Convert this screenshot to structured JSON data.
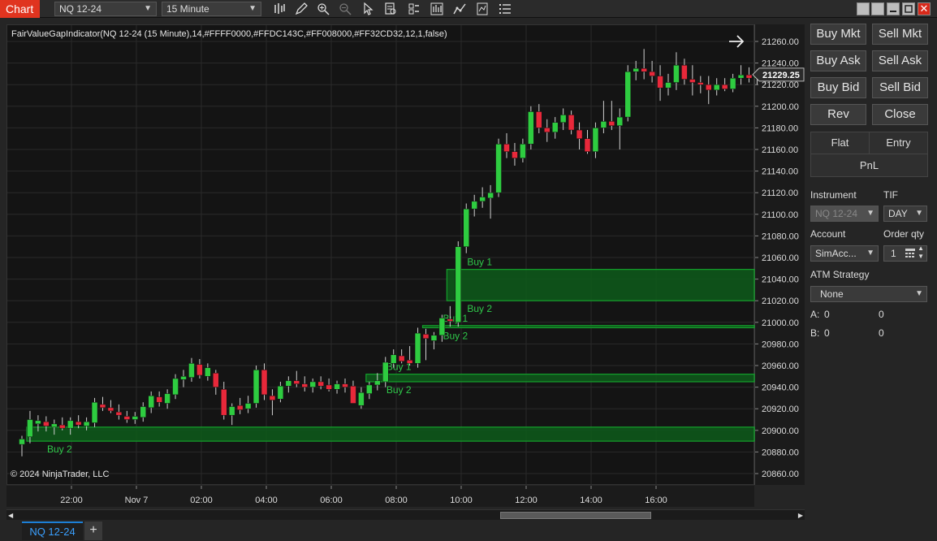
{
  "toolbar": {
    "chart_tab": "Chart",
    "instrument": "NQ 12-24",
    "period": "15 Minute",
    "icons": [
      "bars-icon",
      "pencil-icon",
      "zoom-in-icon",
      "zoom-out-icon",
      "pointer-icon",
      "data-box-icon",
      "properties-icon",
      "strategy-icon",
      "indicator-icon",
      "templates-icon",
      "list-icon"
    ]
  },
  "chart": {
    "indicator_label": "FairValueGapIndicator(NQ 12-24 (15 Minute),14,#FFFF0000,#FFDC143C,#FF008000,#FF32CD32,12,1,false)",
    "copyright": "© 2024 NinjaTrader, LLC",
    "last_price": "21229.25",
    "colors": {
      "up": "#2ecc40",
      "down": "#e8283a",
      "zone_fill": "#0d5a1a",
      "zone_border": "#14a12c",
      "zone_text": "#2fc94a",
      "bg": "#141414",
      "grid": "#2a2a2a"
    }
  },
  "chart_data": {
    "type": "candlestick",
    "y_ticks": [
      "21260.00",
      "21240.00",
      "21220.00",
      "21200.00",
      "21180.00",
      "21160.00",
      "21140.00",
      "21120.00",
      "21100.00",
      "21080.00",
      "21060.00",
      "21040.00",
      "21020.00",
      "21000.00",
      "20980.00",
      "20960.00",
      "20940.00",
      "20920.00",
      "20900.00",
      "20880.00",
      "20860.00"
    ],
    "x_ticks": [
      "22:00",
      "Nov 7",
      "02:00",
      "04:00",
      "06:00",
      "08:00",
      "10:00",
      "12:00",
      "14:00",
      "16:00"
    ],
    "ylim": [
      20848,
      21268
    ],
    "candles": [
      {
        "o": 20887,
        "h": 20895,
        "l": 20876,
        "c": 20892
      },
      {
        "o": 20894,
        "h": 20918,
        "l": 20888,
        "c": 20910
      },
      {
        "o": 20906,
        "h": 20914,
        "l": 20899,
        "c": 20909
      },
      {
        "o": 20908,
        "h": 20913,
        "l": 20899,
        "c": 20904
      },
      {
        "o": 20903,
        "h": 20910,
        "l": 20896,
        "c": 20906
      },
      {
        "o": 20905,
        "h": 20912,
        "l": 20900,
        "c": 20902
      },
      {
        "o": 20902,
        "h": 20912,
        "l": 20896,
        "c": 20909
      },
      {
        "o": 20908,
        "h": 20914,
        "l": 20902,
        "c": 20905
      },
      {
        "o": 20904,
        "h": 20912,
        "l": 20900,
        "c": 20908
      },
      {
        "o": 20907,
        "h": 20930,
        "l": 20903,
        "c": 20926
      },
      {
        "o": 20924,
        "h": 20931,
        "l": 20918,
        "c": 20921
      },
      {
        "o": 20921,
        "h": 20928,
        "l": 20916,
        "c": 20918
      },
      {
        "o": 20917,
        "h": 20924,
        "l": 20910,
        "c": 20914
      },
      {
        "o": 20913,
        "h": 20918,
        "l": 20907,
        "c": 20910
      },
      {
        "o": 20910,
        "h": 20917,
        "l": 20906,
        "c": 20913
      },
      {
        "o": 20912,
        "h": 20926,
        "l": 20908,
        "c": 20922
      },
      {
        "o": 20921,
        "h": 20936,
        "l": 20916,
        "c": 20932
      },
      {
        "o": 20931,
        "h": 20936,
        "l": 20922,
        "c": 20926
      },
      {
        "o": 20925,
        "h": 20938,
        "l": 20920,
        "c": 20934
      },
      {
        "o": 20933,
        "h": 20952,
        "l": 20929,
        "c": 20948
      },
      {
        "o": 20947,
        "h": 20956,
        "l": 20940,
        "c": 20950
      },
      {
        "o": 20949,
        "h": 20967,
        "l": 20945,
        "c": 20962
      },
      {
        "o": 20961,
        "h": 20966,
        "l": 20948,
        "c": 20951
      },
      {
        "o": 20950,
        "h": 20962,
        "l": 20946,
        "c": 20958
      },
      {
        "o": 20953,
        "h": 20956,
        "l": 20933,
        "c": 20940
      },
      {
        "o": 20938,
        "h": 20945,
        "l": 20910,
        "c": 20914
      },
      {
        "o": 20914,
        "h": 20925,
        "l": 20905,
        "c": 20922
      },
      {
        "o": 20923,
        "h": 20930,
        "l": 20915,
        "c": 20919
      },
      {
        "o": 20920,
        "h": 20932,
        "l": 20916,
        "c": 20925
      },
      {
        "o": 20925,
        "h": 20960,
        "l": 20921,
        "c": 20956
      },
      {
        "o": 20956,
        "h": 20962,
        "l": 20928,
        "c": 20933
      },
      {
        "o": 20932,
        "h": 20938,
        "l": 20914,
        "c": 20928
      },
      {
        "o": 20929,
        "h": 20945,
        "l": 20926,
        "c": 20941
      },
      {
        "o": 20941,
        "h": 20950,
        "l": 20935,
        "c": 20946
      },
      {
        "o": 20946,
        "h": 20955,
        "l": 20940,
        "c": 20943
      },
      {
        "o": 20943,
        "h": 20950,
        "l": 20936,
        "c": 20940
      },
      {
        "o": 20940,
        "h": 20948,
        "l": 20935,
        "c": 20945
      },
      {
        "o": 20945,
        "h": 20950,
        "l": 20938,
        "c": 20941
      },
      {
        "o": 20942,
        "h": 20948,
        "l": 20936,
        "c": 20938
      },
      {
        "o": 20938,
        "h": 20946,
        "l": 20934,
        "c": 20943
      },
      {
        "o": 20943,
        "h": 20948,
        "l": 20935,
        "c": 20940
      },
      {
        "o": 20941,
        "h": 20946,
        "l": 20925,
        "c": 20925
      },
      {
        "o": 20923,
        "h": 20940,
        "l": 20920,
        "c": 20935
      },
      {
        "o": 20934,
        "h": 20945,
        "l": 20929,
        "c": 20942
      },
      {
        "o": 20942,
        "h": 20953,
        "l": 20937,
        "c": 20946
      },
      {
        "o": 20945,
        "h": 20968,
        "l": 20940,
        "c": 20963
      },
      {
        "o": 20962,
        "h": 20975,
        "l": 20958,
        "c": 20970
      },
      {
        "o": 20969,
        "h": 20975,
        "l": 20962,
        "c": 20964
      },
      {
        "o": 20965,
        "h": 20978,
        "l": 20960,
        "c": 20962
      },
      {
        "o": 20962,
        "h": 20995,
        "l": 20958,
        "c": 20990
      },
      {
        "o": 20989,
        "h": 20994,
        "l": 20965,
        "c": 20985
      },
      {
        "o": 20983,
        "h": 20991,
        "l": 20975,
        "c": 20988
      },
      {
        "o": 20988,
        "h": 21007,
        "l": 20982,
        "c": 21004
      },
      {
        "o": 21003,
        "h": 21015,
        "l": 20996,
        "c": 21001
      },
      {
        "o": 21000,
        "h": 21075,
        "l": 20996,
        "c": 21070
      },
      {
        "o": 21070,
        "h": 21110,
        "l": 21064,
        "c": 21105
      },
      {
        "o": 21105,
        "h": 21118,
        "l": 21098,
        "c": 21112
      },
      {
        "o": 21112,
        "h": 21125,
        "l": 21106,
        "c": 21116
      },
      {
        "o": 21115,
        "h": 21127,
        "l": 21096,
        "c": 21120
      },
      {
        "o": 21120,
        "h": 21170,
        "l": 21116,
        "c": 21165
      },
      {
        "o": 21165,
        "h": 21175,
        "l": 21152,
        "c": 21158
      },
      {
        "o": 21158,
        "h": 21166,
        "l": 21145,
        "c": 21152
      },
      {
        "o": 21152,
        "h": 21170,
        "l": 21148,
        "c": 21165
      },
      {
        "o": 21165,
        "h": 21200,
        "l": 21160,
        "c": 21195
      },
      {
        "o": 21195,
        "h": 21202,
        "l": 21175,
        "c": 21180
      },
      {
        "o": 21180,
        "h": 21188,
        "l": 21167,
        "c": 21176
      },
      {
        "o": 21176,
        "h": 21190,
        "l": 21170,
        "c": 21185
      },
      {
        "o": 21185,
        "h": 21198,
        "l": 21178,
        "c": 21192
      },
      {
        "o": 21192,
        "h": 21196,
        "l": 21174,
        "c": 21178
      },
      {
        "o": 21178,
        "h": 21185,
        "l": 21160,
        "c": 21170
      },
      {
        "o": 21170,
        "h": 21178,
        "l": 21156,
        "c": 21158
      },
      {
        "o": 21158,
        "h": 21185,
        "l": 21152,
        "c": 21180
      },
      {
        "o": 21180,
        "h": 21205,
        "l": 21175,
        "c": 21186
      },
      {
        "o": 21186,
        "h": 21205,
        "l": 21178,
        "c": 21182
      },
      {
        "o": 21182,
        "h": 21198,
        "l": 21160,
        "c": 21190
      },
      {
        "o": 21190,
        "h": 21238,
        "l": 21186,
        "c": 21232
      },
      {
        "o": 21232,
        "h": 21242,
        "l": 21224,
        "c": 21235
      },
      {
        "o": 21235,
        "h": 21253,
        "l": 21225,
        "c": 21232
      },
      {
        "o": 21232,
        "h": 21242,
        "l": 21222,
        "c": 21228
      },
      {
        "o": 21228,
        "h": 21238,
        "l": 21205,
        "c": 21217
      },
      {
        "o": 21217,
        "h": 21230,
        "l": 21210,
        "c": 21222
      },
      {
        "o": 21222,
        "h": 21250,
        "l": 21215,
        "c": 21238
      },
      {
        "o": 21238,
        "h": 21244,
        "l": 21220,
        "c": 21225
      },
      {
        "o": 21225,
        "h": 21238,
        "l": 21210,
        "c": 21222
      },
      {
        "o": 21222,
        "h": 21228,
        "l": 21212,
        "c": 21220
      },
      {
        "o": 21220,
        "h": 21228,
        "l": 21202,
        "c": 21215
      },
      {
        "o": 21215,
        "h": 21226,
        "l": 21210,
        "c": 21220
      },
      {
        "o": 21220,
        "h": 21226,
        "l": 21214,
        "c": 21216
      },
      {
        "o": 21216,
        "h": 21230,
        "l": 21213,
        "c": 21226
      },
      {
        "o": 21226,
        "h": 21238,
        "l": 21220,
        "c": 21229
      },
      {
        "o": 21229,
        "h": 21236,
        "l": 21222,
        "c": 21226
      },
      {
        "o": 21226,
        "h": 21234,
        "l": 21220,
        "c": 21231
      },
      {
        "o": 21231,
        "h": 21235,
        "l": 21220,
        "c": 21229
      }
    ],
    "zones": [
      {
        "top": 20903,
        "bottom": 20890,
        "start": 1,
        "labels": [
          {
            "text": "Buy 2",
            "pos": "below"
          }
        ]
      },
      {
        "top": 20952,
        "bottom": 20945,
        "start": 43,
        "labels": [
          {
            "text": "Buy 1",
            "pos": "above"
          },
          {
            "text": "Buy 2",
            "pos": "below"
          }
        ]
      },
      {
        "top": 20997,
        "bottom": 20995,
        "start": 50,
        "labels": [
          {
            "text": "Buy 1",
            "pos": "above"
          },
          {
            "text": "Buy 2",
            "pos": "below"
          }
        ]
      },
      {
        "top": 21049,
        "bottom": 21020,
        "start": 53,
        "labels": [
          {
            "text": "Buy 1",
            "pos": "above"
          },
          {
            "text": "Buy 2",
            "pos": "below"
          }
        ]
      }
    ]
  },
  "order_panel": {
    "buy_mkt": "Buy Mkt",
    "sell_mkt": "Sell Mkt",
    "buy_ask": "Buy Ask",
    "sell_ask": "Sell Ask",
    "buy_bid": "Buy Bid",
    "sell_bid": "Sell Bid",
    "rev": "Rev",
    "close": "Close",
    "flat": "Flat",
    "entry": "Entry",
    "pnl": "PnL",
    "instrument_label": "Instrument",
    "tif_label": "TIF",
    "instrument_value": "NQ 12-24",
    "tif_value": "DAY",
    "account_label": "Account",
    "order_qty_label": "Order qty",
    "account_value": "SimAcc...",
    "order_qty_value": "1",
    "atm_label": "ATM Strategy",
    "atm_value": "None",
    "a_label": "A:",
    "a_val1": "0",
    "a_val2": "0",
    "b_label": "B:",
    "b_val1": "0",
    "b_val2": "0"
  },
  "bottom": {
    "tab": "NQ 12-24",
    "add": "+"
  }
}
